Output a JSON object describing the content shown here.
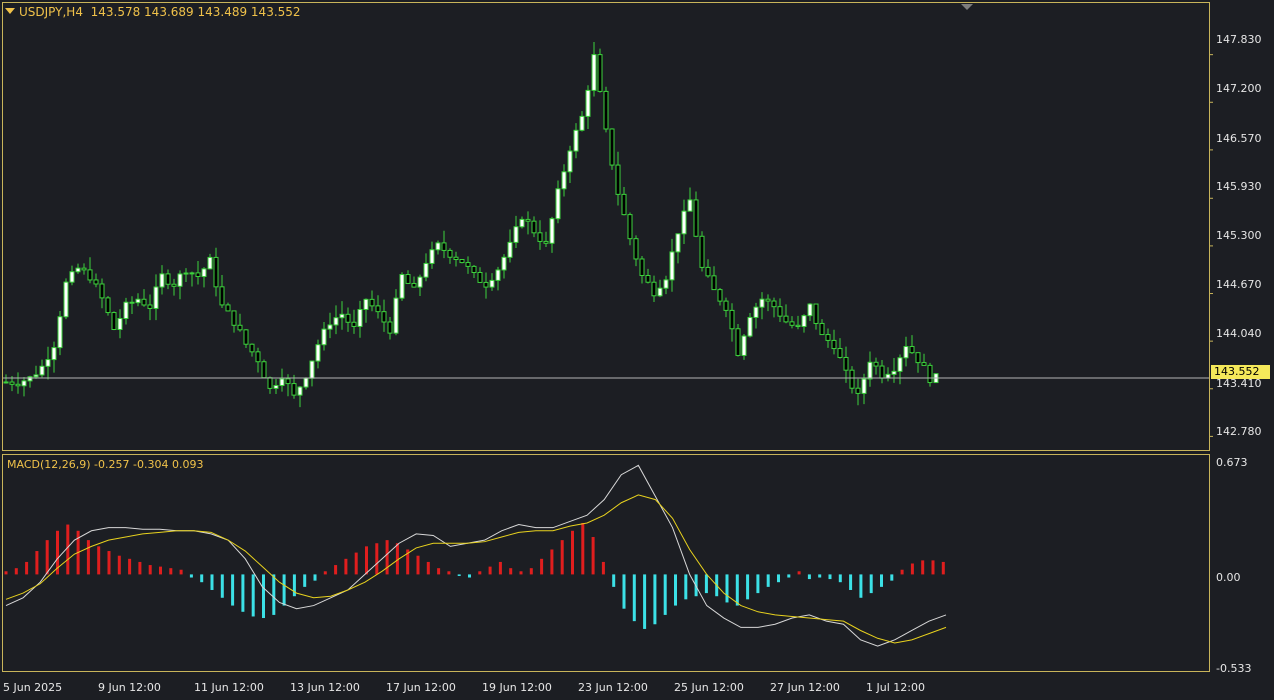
{
  "header": {
    "symbol": "USDJPY,H4",
    "ohlc": "143.578 143.689 143.489 143.552"
  },
  "macd_header": "MACD(12,26,9) -0.257 -0.304 0.093",
  "current_price": "143.552",
  "colors": {
    "background": "#1c1e23",
    "frame": "#c8b45a",
    "bull_fill": "#ffffff",
    "candle_outline": "#3cd23c",
    "hist_positive": "#e01e1e",
    "hist_negative": "#3ce1e6",
    "macd_line": "#d8d8d8",
    "signal_line": "#e8d21e",
    "price_line": "#b4b4b4",
    "price_tag": "#f5e95a"
  },
  "chart_data": [
    {
      "type": "candlestick",
      "title": "USDJPY,H4",
      "y_ticks": [
        "147.830",
        "147.200",
        "146.570",
        "145.930",
        "145.300",
        "144.670",
        "144.040",
        "143.410",
        "142.780"
      ],
      "ylim": [
        142.6,
        148.5
      ],
      "x_tick_labels": [
        "5 Jun 2025",
        "9 Jun 12:00",
        "11 Jun 12:00",
        "13 Jun 12:00",
        "17 Jun 12:00",
        "19 Jun 12:00",
        "23 Jun 12:00",
        "25 Jun 12:00",
        "27 Jun 12:00",
        "1 Jul 12:00"
      ],
      "close_path": [
        143.5,
        143.5,
        143.55,
        143.7,
        144.0,
        144.8,
        145.0,
        144.9,
        144.6,
        144.2,
        144.5,
        144.6,
        144.5,
        144.9,
        144.8,
        145.0,
        144.9,
        145.1,
        144.5,
        144.3,
        144.0,
        143.8,
        143.4,
        143.6,
        143.3,
        143.6,
        144.0,
        144.3,
        144.4,
        144.2,
        144.6,
        144.4,
        144.2,
        144.9,
        144.7,
        145.1,
        145.3,
        145.2,
        145.1,
        144.9,
        144.8,
        145.0,
        145.3,
        145.7,
        145.5,
        145.3,
        146.0,
        146.6,
        147.0,
        147.8,
        146.8,
        146.0,
        145.4,
        144.9,
        144.7,
        144.9,
        145.5,
        145.9,
        145.0,
        144.7,
        144.5,
        143.9,
        144.4,
        144.6,
        144.5,
        144.3,
        144.2,
        144.5,
        144.1,
        144.0,
        143.6,
        143.3,
        143.8,
        143.6,
        143.7,
        144.0,
        143.8,
        143.55
      ],
      "current_price": 143.552
    },
    {
      "type": "bar+line",
      "title": "MACD(12,26,9)",
      "y_ticks": [
        "0.673",
        "0.00",
        "-0.533"
      ],
      "ylim": [
        -0.62,
        0.76
      ],
      "histogram": [
        0.02,
        0.04,
        0.08,
        0.15,
        0.22,
        0.28,
        0.32,
        0.28,
        0.22,
        0.18,
        0.15,
        0.12,
        0.1,
        0.08,
        0.06,
        0.05,
        0.04,
        0.03,
        -0.02,
        -0.05,
        -0.1,
        -0.15,
        -0.2,
        -0.24,
        -0.27,
        -0.28,
        -0.26,
        -0.2,
        -0.14,
        -0.08,
        -0.04,
        0.02,
        0.06,
        0.1,
        0.14,
        0.18,
        0.2,
        0.22,
        0.2,
        0.16,
        0.12,
        0.08,
        0.04,
        0.02,
        -0.01,
        -0.02,
        0.02,
        0.05,
        0.08,
        0.04,
        0.02,
        0.04,
        0.1,
        0.16,
        0.22,
        0.28,
        0.33,
        0.24,
        0.08,
        -0.08,
        -0.22,
        -0.3,
        -0.35,
        -0.32,
        -0.26,
        -0.2,
        -0.16,
        -0.14,
        -0.12,
        -0.14,
        -0.18,
        -0.2,
        -0.16,
        -0.12,
        -0.08,
        -0.05,
        -0.02,
        0.02,
        -0.03,
        -0.02,
        -0.03,
        -0.05,
        -0.1,
        -0.15,
        -0.12,
        -0.08,
        -0.04,
        0.03,
        0.07,
        0.09,
        0.09,
        0.08
      ],
      "macd_line": [
        -0.2,
        -0.15,
        -0.05,
        0.1,
        0.22,
        0.28,
        0.3,
        0.3,
        0.29,
        0.29,
        0.28,
        0.28,
        0.26,
        0.22,
        0.1,
        -0.08,
        -0.18,
        -0.22,
        -0.2,
        -0.15,
        -0.1,
        0.0,
        0.1,
        0.2,
        0.26,
        0.25,
        0.18,
        0.2,
        0.22,
        0.28,
        0.32,
        0.3,
        0.3,
        0.34,
        0.38,
        0.48,
        0.64,
        0.7,
        0.5,
        0.3,
        0.0,
        -0.2,
        -0.28,
        -0.34,
        -0.34,
        -0.32,
        -0.28,
        -0.26,
        -0.3,
        -0.32,
        -0.42,
        -0.46,
        -0.42,
        -0.36,
        -0.3,
        -0.26
      ],
      "signal_line": [
        -0.16,
        -0.12,
        -0.06,
        0.04,
        0.13,
        0.18,
        0.22,
        0.24,
        0.26,
        0.27,
        0.28,
        0.28,
        0.27,
        0.22,
        0.15,
        0.05,
        -0.05,
        -0.12,
        -0.15,
        -0.14,
        -0.1,
        -0.05,
        0.02,
        0.1,
        0.17,
        0.2,
        0.2,
        0.2,
        0.21,
        0.24,
        0.27,
        0.28,
        0.28,
        0.31,
        0.33,
        0.38,
        0.46,
        0.51,
        0.48,
        0.36,
        0.16,
        0.0,
        -0.12,
        -0.2,
        -0.24,
        -0.26,
        -0.27,
        -0.28,
        -0.29,
        -0.3,
        -0.36,
        -0.41,
        -0.44,
        -0.42,
        -0.38,
        -0.34
      ]
    }
  ]
}
